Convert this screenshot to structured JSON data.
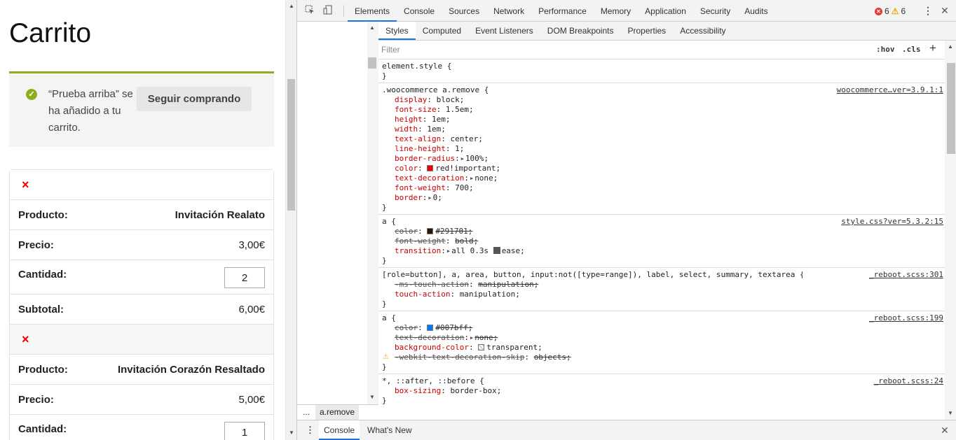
{
  "page": {
    "title": "Carrito",
    "notice": {
      "message": "“Prueba arriba” se ha añadido a tu carrito.",
      "button": "Seguir comprando"
    },
    "items": [
      {
        "product_label": "Producto:",
        "product": "Invitación Realato",
        "price_label": "Precio:",
        "price": "3,00€",
        "qty_label": "Cantidad:",
        "qty": "2",
        "subtotal_label": "Subtotal:",
        "subtotal": "6,00€"
      },
      {
        "product_label": "Producto:",
        "product": "Invitación Corazón Resaltado",
        "price_label": "Precio:",
        "price": "5,00€",
        "qty_label": "Cantidad:",
        "qty": "1"
      }
    ],
    "remove_icon": "×",
    "colors": {
      "accent": "#8fae1b",
      "remove": "#ee0000"
    }
  },
  "devtools": {
    "tabs": [
      "Elements",
      "Console",
      "Sources",
      "Network",
      "Performance",
      "Memory",
      "Application",
      "Security",
      "Audits"
    ],
    "active_tab": "Elements",
    "errors": "6",
    "warnings": "6",
    "subtabs": [
      "Styles",
      "Computed",
      "Event Listeners",
      "DOM Breakpoints",
      "Properties",
      "Accessibility"
    ],
    "active_subtab": "Styles",
    "filter_placeholder": "Filter",
    "hov": ":hov",
    "cls": ".cls",
    "breadcrumb": {
      "dots": "...",
      "selected": "a.remove"
    },
    "drawer_tabs": [
      "Console",
      "What's New"
    ],
    "rules": {
      "r0": {
        "selector": "element.style {",
        "close": "}"
      },
      "r1": {
        "selector": ".woocommerce a.remove {",
        "source": "woocommerce…ver=3.9.1:1",
        "decls": [
          {
            "p": "display",
            "v": "block;"
          },
          {
            "p": "font-size",
            "v": "1.5em;"
          },
          {
            "p": "height",
            "v": "1em;"
          },
          {
            "p": "width",
            "v": "1em;"
          },
          {
            "p": "text-align",
            "v": "center;"
          },
          {
            "p": "line-height",
            "v": "1;"
          },
          {
            "p": "border-radius",
            "v": "100%;"
          },
          {
            "p": "color",
            "v": "red!important;"
          },
          {
            "p": "text-decoration",
            "v": "none;"
          },
          {
            "p": "font-weight",
            "v": "700;"
          },
          {
            "p": "border",
            "v": "0;"
          }
        ],
        "close": "}"
      },
      "r2": {
        "selector": "a {",
        "source": "style.css?ver=5.3.2:15",
        "decls": [
          {
            "p": "color",
            "v": "#291701;"
          },
          {
            "p": "font-weight",
            "v": "bold;"
          },
          {
            "p": "transition",
            "v": "all 0.3s",
            "v2": "ease;"
          }
        ],
        "close": "}"
      },
      "r3": {
        "selector": "[role=button], a, area, button, input:not([type=range]), label, select, summary, textarea {",
        "source": "_reboot.scss:301",
        "decls": [
          {
            "p": "-ms-touch-action",
            "v": "manipulation;"
          },
          {
            "p": "touch-action",
            "v": "manipulation;"
          }
        ],
        "close": "}"
      },
      "r4": {
        "selector": "a {",
        "source": "_reboot.scss:199",
        "decls": [
          {
            "p": "color",
            "v": "#007bff;"
          },
          {
            "p": "text-decoration",
            "v": "none;"
          },
          {
            "p": "background-color",
            "v": "transparent;"
          },
          {
            "p": "-webkit-text-decoration-skip",
            "v": "objects;"
          }
        ],
        "close": "}"
      },
      "r5": {
        "selector": "*, ::after, ::before {",
        "source": "_reboot.scss:24",
        "decls": [
          {
            "p": "box-sizing",
            "v": "border-box;"
          }
        ],
        "close": "}"
      }
    },
    "swatches": {
      "red": "#ee0000",
      "brown": "#291701",
      "blue": "#007bff"
    }
  }
}
